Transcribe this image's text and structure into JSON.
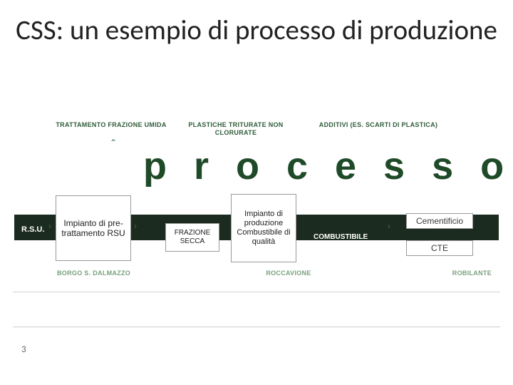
{
  "title": "CSS: un esempio di processo di produzione",
  "top_labels": {
    "l1": "TRATTAMENTO FRAZIONE UMIDA",
    "l2": "PLASTICHE TRITURATE NON CLORURATE",
    "l3": "ADDITIVI (ES. SCARTI DI PLASTICA)"
  },
  "processo_word": "processo",
  "flow": {
    "rsu": "R.S.U.",
    "impianto1": "Impianto\ndi pre-trattamento RSU",
    "frazione": "FRAZIONE SECCA",
    "impianto2": "Impianto di produzione Combustibile\ndi qualità",
    "combustibile": "COMBUSTIBILE",
    "out1": "Cementificio",
    "out2": "CTE"
  },
  "locations": {
    "l1": "BORGO S. DALMAZZO",
    "l2": "ROCCAVIONE",
    "l3": "ROBILANTE"
  },
  "page_number": "3"
}
